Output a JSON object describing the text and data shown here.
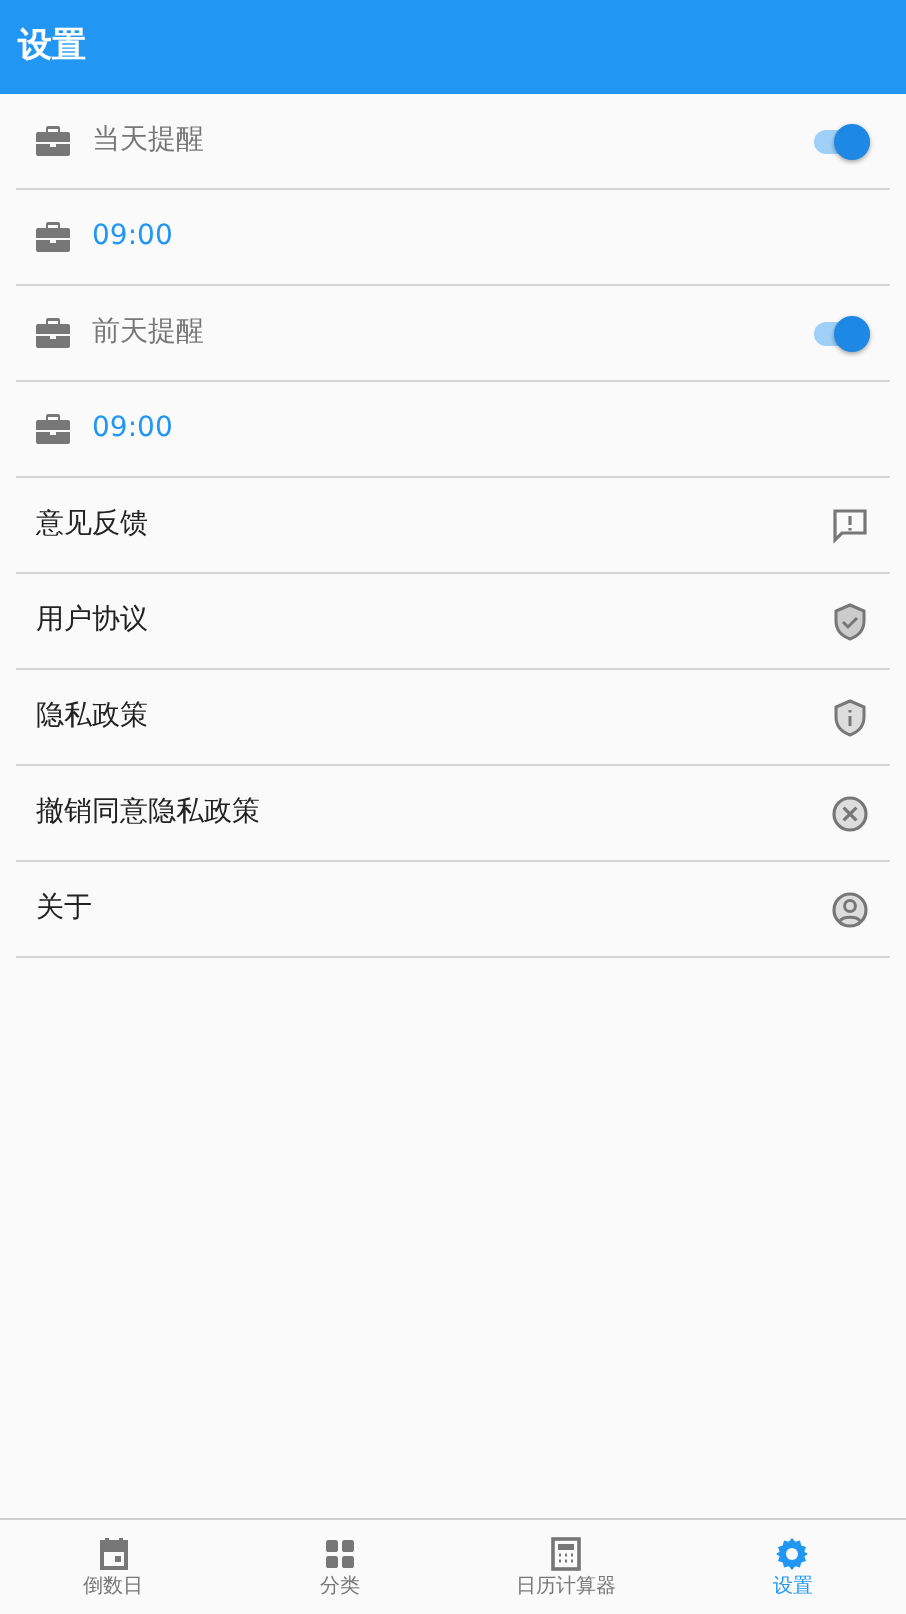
{
  "app_bar": {
    "title": "设置"
  },
  "settings": [
    {
      "kind": "toggle",
      "label": "当天提醒",
      "on": true
    },
    {
      "kind": "time",
      "value": "09:00"
    },
    {
      "kind": "toggle",
      "label": "前天提醒",
      "on": true
    },
    {
      "kind": "time",
      "value": "09:00"
    },
    {
      "kind": "link",
      "label": "意见反馈"
    },
    {
      "kind": "link",
      "label": "用户协议"
    },
    {
      "kind": "link",
      "label": "隐私政策"
    },
    {
      "kind": "link",
      "label": "撤销同意隐私政策"
    },
    {
      "kind": "link",
      "label": "关于"
    }
  ],
  "bottom_nav": [
    {
      "label": "倒数日",
      "selected": false
    },
    {
      "label": "分类",
      "selected": false
    },
    {
      "label": "日历计算器",
      "selected": false
    },
    {
      "label": "设置",
      "selected": true
    }
  ]
}
